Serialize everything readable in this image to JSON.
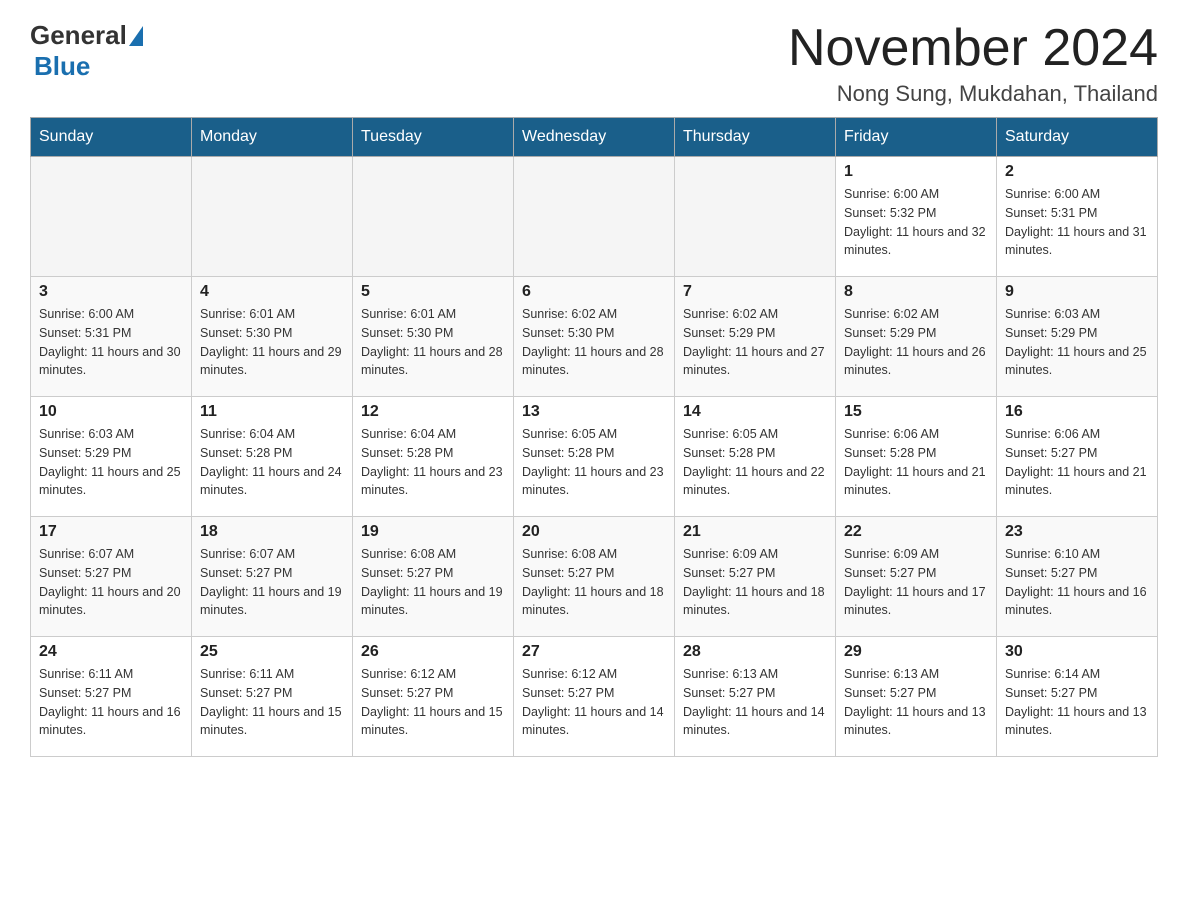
{
  "header": {
    "logo_general": "General",
    "logo_blue": "Blue",
    "month_title": "November 2024",
    "location": "Nong Sung, Mukdahan, Thailand"
  },
  "days_of_week": [
    "Sunday",
    "Monday",
    "Tuesday",
    "Wednesday",
    "Thursday",
    "Friday",
    "Saturday"
  ],
  "weeks": [
    [
      {
        "day": "",
        "info": ""
      },
      {
        "day": "",
        "info": ""
      },
      {
        "day": "",
        "info": ""
      },
      {
        "day": "",
        "info": ""
      },
      {
        "day": "",
        "info": ""
      },
      {
        "day": "1",
        "info": "Sunrise: 6:00 AM\nSunset: 5:32 PM\nDaylight: 11 hours and 32 minutes."
      },
      {
        "day": "2",
        "info": "Sunrise: 6:00 AM\nSunset: 5:31 PM\nDaylight: 11 hours and 31 minutes."
      }
    ],
    [
      {
        "day": "3",
        "info": "Sunrise: 6:00 AM\nSunset: 5:31 PM\nDaylight: 11 hours and 30 minutes."
      },
      {
        "day": "4",
        "info": "Sunrise: 6:01 AM\nSunset: 5:30 PM\nDaylight: 11 hours and 29 minutes."
      },
      {
        "day": "5",
        "info": "Sunrise: 6:01 AM\nSunset: 5:30 PM\nDaylight: 11 hours and 28 minutes."
      },
      {
        "day": "6",
        "info": "Sunrise: 6:02 AM\nSunset: 5:30 PM\nDaylight: 11 hours and 28 minutes."
      },
      {
        "day": "7",
        "info": "Sunrise: 6:02 AM\nSunset: 5:29 PM\nDaylight: 11 hours and 27 minutes."
      },
      {
        "day": "8",
        "info": "Sunrise: 6:02 AM\nSunset: 5:29 PM\nDaylight: 11 hours and 26 minutes."
      },
      {
        "day": "9",
        "info": "Sunrise: 6:03 AM\nSunset: 5:29 PM\nDaylight: 11 hours and 25 minutes."
      }
    ],
    [
      {
        "day": "10",
        "info": "Sunrise: 6:03 AM\nSunset: 5:29 PM\nDaylight: 11 hours and 25 minutes."
      },
      {
        "day": "11",
        "info": "Sunrise: 6:04 AM\nSunset: 5:28 PM\nDaylight: 11 hours and 24 minutes."
      },
      {
        "day": "12",
        "info": "Sunrise: 6:04 AM\nSunset: 5:28 PM\nDaylight: 11 hours and 23 minutes."
      },
      {
        "day": "13",
        "info": "Sunrise: 6:05 AM\nSunset: 5:28 PM\nDaylight: 11 hours and 23 minutes."
      },
      {
        "day": "14",
        "info": "Sunrise: 6:05 AM\nSunset: 5:28 PM\nDaylight: 11 hours and 22 minutes."
      },
      {
        "day": "15",
        "info": "Sunrise: 6:06 AM\nSunset: 5:28 PM\nDaylight: 11 hours and 21 minutes."
      },
      {
        "day": "16",
        "info": "Sunrise: 6:06 AM\nSunset: 5:27 PM\nDaylight: 11 hours and 21 minutes."
      }
    ],
    [
      {
        "day": "17",
        "info": "Sunrise: 6:07 AM\nSunset: 5:27 PM\nDaylight: 11 hours and 20 minutes."
      },
      {
        "day": "18",
        "info": "Sunrise: 6:07 AM\nSunset: 5:27 PM\nDaylight: 11 hours and 19 minutes."
      },
      {
        "day": "19",
        "info": "Sunrise: 6:08 AM\nSunset: 5:27 PM\nDaylight: 11 hours and 19 minutes."
      },
      {
        "day": "20",
        "info": "Sunrise: 6:08 AM\nSunset: 5:27 PM\nDaylight: 11 hours and 18 minutes."
      },
      {
        "day": "21",
        "info": "Sunrise: 6:09 AM\nSunset: 5:27 PM\nDaylight: 11 hours and 18 minutes."
      },
      {
        "day": "22",
        "info": "Sunrise: 6:09 AM\nSunset: 5:27 PM\nDaylight: 11 hours and 17 minutes."
      },
      {
        "day": "23",
        "info": "Sunrise: 6:10 AM\nSunset: 5:27 PM\nDaylight: 11 hours and 16 minutes."
      }
    ],
    [
      {
        "day": "24",
        "info": "Sunrise: 6:11 AM\nSunset: 5:27 PM\nDaylight: 11 hours and 16 minutes."
      },
      {
        "day": "25",
        "info": "Sunrise: 6:11 AM\nSunset: 5:27 PM\nDaylight: 11 hours and 15 minutes."
      },
      {
        "day": "26",
        "info": "Sunrise: 6:12 AM\nSunset: 5:27 PM\nDaylight: 11 hours and 15 minutes."
      },
      {
        "day": "27",
        "info": "Sunrise: 6:12 AM\nSunset: 5:27 PM\nDaylight: 11 hours and 14 minutes."
      },
      {
        "day": "28",
        "info": "Sunrise: 6:13 AM\nSunset: 5:27 PM\nDaylight: 11 hours and 14 minutes."
      },
      {
        "day": "29",
        "info": "Sunrise: 6:13 AM\nSunset: 5:27 PM\nDaylight: 11 hours and 13 minutes."
      },
      {
        "day": "30",
        "info": "Sunrise: 6:14 AM\nSunset: 5:27 PM\nDaylight: 11 hours and 13 minutes."
      }
    ]
  ]
}
